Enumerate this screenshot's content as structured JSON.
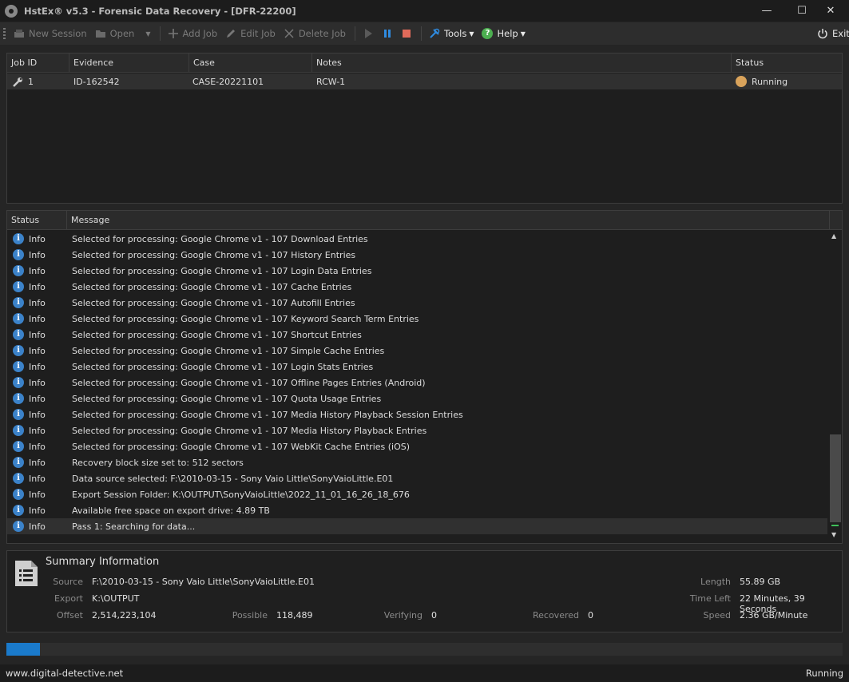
{
  "window": {
    "title": "HstEx® v5.3 - Forensic Data Recovery - [DFR-22200]"
  },
  "toolbar": {
    "new_session": "New Session",
    "open": "Open",
    "add_job": "Add Job",
    "edit_job": "Edit Job",
    "delete_job": "Delete Job",
    "tools": "Tools",
    "help": "Help",
    "exit": "Exit"
  },
  "jobs": {
    "headers": {
      "job_id": "Job ID",
      "evidence": "Evidence",
      "case": "Case",
      "notes": "Notes",
      "status": "Status"
    },
    "rows": [
      {
        "job_id": "1",
        "evidence": "ID-162542",
        "case": "CASE-20221101",
        "notes": "RCW-1",
        "status": "Running",
        "status_color": "#d9a35b"
      }
    ]
  },
  "log": {
    "headers": {
      "status": "Status",
      "message": "Message"
    },
    "rows": [
      {
        "status": "Info",
        "message": "Selected for processing: Google Chrome v1 - 107 Download Entries"
      },
      {
        "status": "Info",
        "message": "Selected for processing: Google Chrome v1 - 107 History Entries"
      },
      {
        "status": "Info",
        "message": "Selected for processing: Google Chrome v1 - 107 Login Data Entries"
      },
      {
        "status": "Info",
        "message": "Selected for processing: Google Chrome v1 - 107 Cache Entries"
      },
      {
        "status": "Info",
        "message": "Selected for processing: Google Chrome v1 - 107 Autofill Entries"
      },
      {
        "status": "Info",
        "message": "Selected for processing: Google Chrome v1 - 107 Keyword Search Term Entries"
      },
      {
        "status": "Info",
        "message": "Selected for processing: Google Chrome v1 - 107 Shortcut Entries"
      },
      {
        "status": "Info",
        "message": "Selected for processing: Google Chrome v1 - 107 Simple Cache Entries"
      },
      {
        "status": "Info",
        "message": "Selected for processing: Google Chrome v1 - 107 Login Stats Entries"
      },
      {
        "status": "Info",
        "message": "Selected for processing: Google Chrome v1 - 107 Offline Pages Entries (Android)"
      },
      {
        "status": "Info",
        "message": "Selected for processing: Google Chrome v1 - 107 Quota Usage Entries"
      },
      {
        "status": "Info",
        "message": "Selected for processing: Google Chrome v1 - 107 Media History Playback Session Entries"
      },
      {
        "status": "Info",
        "message": "Selected for processing: Google Chrome v1 - 107 Media History Playback Entries"
      },
      {
        "status": "Info",
        "message": "Selected for processing: Google Chrome v1 - 107 WebKit Cache Entries (iOS)"
      },
      {
        "status": "Info",
        "message": "Recovery block size set to: 512 sectors"
      },
      {
        "status": "Info",
        "message": "Data source selected: F:\\2010-03-15 - Sony Vaio Little\\SonyVaioLittle.E01"
      },
      {
        "status": "Info",
        "message": "Export Session Folder: K:\\OUTPUT\\SonyVaioLittle\\2022_11_01_16_26_18_676"
      },
      {
        "status": "Info",
        "message": "Available free space on export drive: 4.89 TB"
      },
      {
        "status": "Info",
        "message": "Pass 1: Searching for data..."
      }
    ]
  },
  "summary": {
    "title": "Summary Information",
    "source_label": "Source",
    "source": "F:\\2010-03-15 - Sony Vaio Little\\SonyVaioLittle.E01",
    "export_label": "Export",
    "export": "K:\\OUTPUT",
    "offset_label": "Offset",
    "offset": "2,514,223,104",
    "possible_label": "Possible",
    "possible": "118,489",
    "verifying_label": "Verifying",
    "verifying": "0",
    "recovered_label": "Recovered",
    "recovered": "0",
    "length_label": "Length",
    "length": "55.89 GB",
    "time_left_label": "Time Left",
    "time_left": "22 Minutes, 39 Seconds",
    "speed_label": "Speed",
    "speed": "2.36 GB/Minute"
  },
  "progress": {
    "fraction": 0.04
  },
  "statusbar": {
    "url": "www.digital-detective.net",
    "state": "Running"
  },
  "colors": {
    "accent": "#1a7acb",
    "info": "#3b82c9",
    "running": "#d9a35b"
  }
}
